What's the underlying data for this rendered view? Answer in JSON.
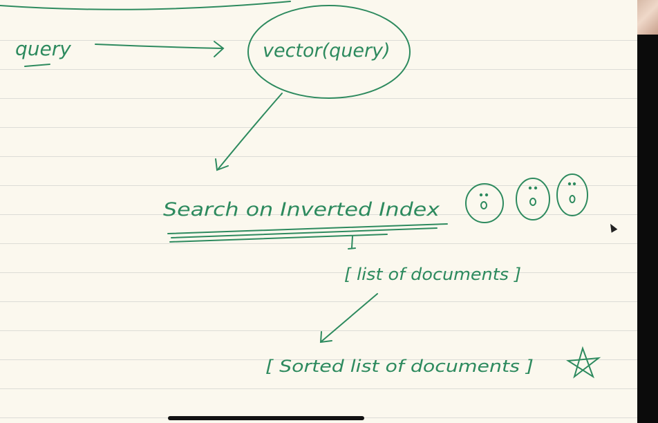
{
  "diagram": {
    "query": "query",
    "vector_query": "vector(query)",
    "search": "Search on Inverted Index",
    "list_docs": "[ list of documents ]",
    "sorted_docs": "[ Sorted list of documents ]"
  },
  "ink_color": "#2d8a5e"
}
